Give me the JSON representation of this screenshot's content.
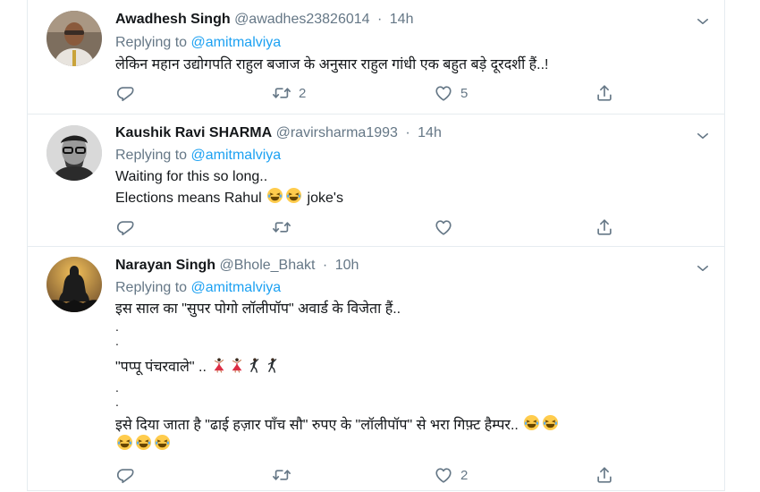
{
  "tweets": [
    {
      "name": "Awadhesh Singh",
      "handle": "@awadhes23826014",
      "time": "14h",
      "replying_label": "Replying to",
      "replying_to": "@amitmalviya",
      "lines": [
        "लेकिन महान उद्योगपति राहुल बजाज के अनुसार  राहुल गांधी एक बहुत बड़े दूरदर्शी हैं..!"
      ],
      "retweets": "2",
      "likes": "5"
    },
    {
      "name": "Kaushik Ravi SHARMA",
      "handle": "@ravirsharma1993",
      "time": "14h",
      "replying_label": "Replying to",
      "replying_to": "@amitmalviya",
      "lines": [
        "Waiting for this so long..",
        "Elections means Rahul",
        "joke's"
      ],
      "retweets": "",
      "likes": ""
    },
    {
      "name": "Narayan Singh",
      "handle": "@Bhole_Bhakt",
      "time": "10h",
      "replying_label": "Replying to",
      "replying_to": "@amitmalviya",
      "lines": [
        "इस साल का \"सुपर पोगो लॉलीपॉप\" अवार्ड के विजेता हैं..",
        ".",
        ".",
        "\"पप्पू पंचरवाले\" ..",
        ".",
        ".",
        "इसे दिया जाता है \"ढाई हज़ार पाँच सौ\" रुपए के \"लॉलीपॉप\" से भरा गिफ़्ट हैम्पर.."
      ],
      "retweets": "",
      "likes": "2"
    }
  ],
  "separator": "·",
  "icons": [
    "reply-icon",
    "retweet-icon",
    "like-icon",
    "share-icon",
    "chevron-down-icon",
    "laughing-emoji",
    "dancer-emoji",
    "man-dancing-emoji"
  ],
  "colors": {
    "text": "#14171a",
    "muted": "#657786",
    "link": "#1da1f2",
    "border": "#e6ecf0"
  }
}
